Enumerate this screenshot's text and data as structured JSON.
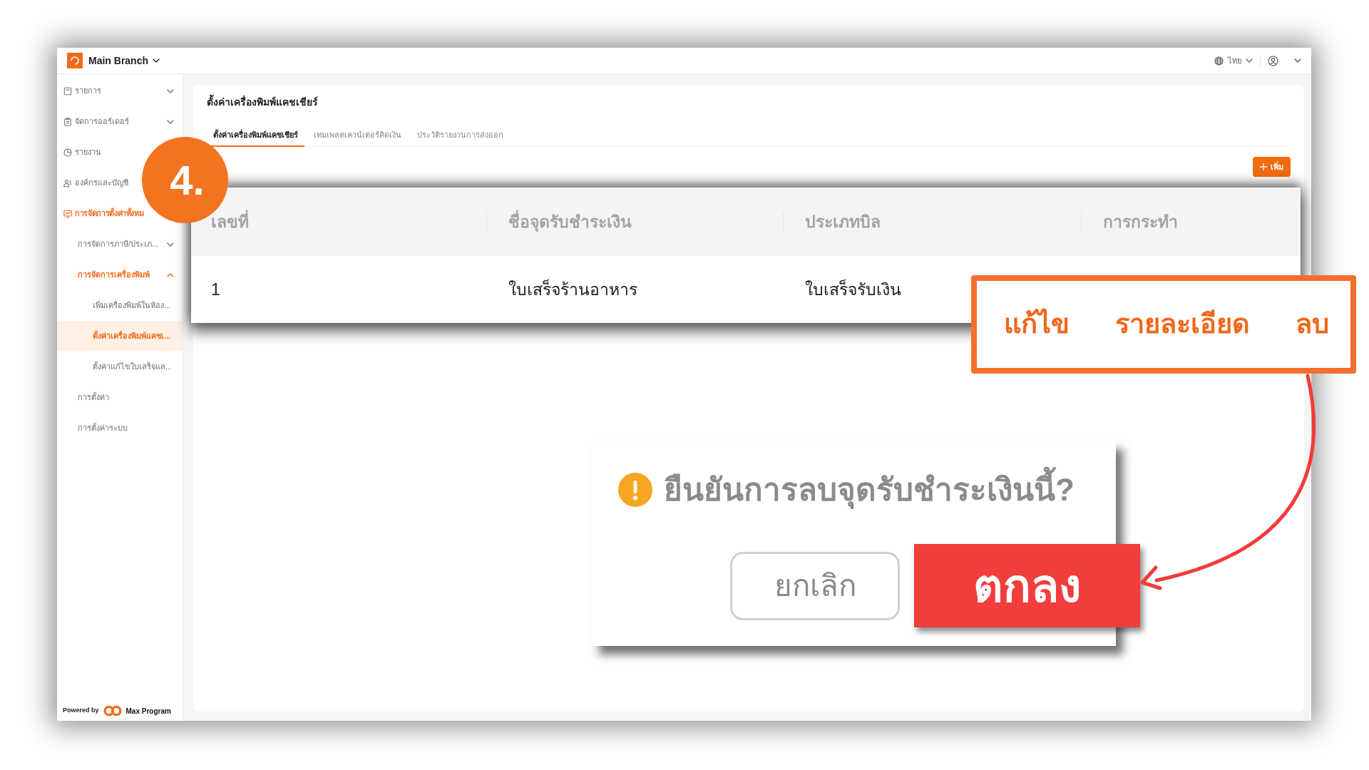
{
  "top_bar": {
    "branch": "Main Branch",
    "language": "ไทย"
  },
  "sidebar": {
    "items": [
      {
        "label": "รายการ",
        "expanded": false,
        "selected": false
      },
      {
        "label": "จัดการออร์เดอร์",
        "expanded": false,
        "selected": false
      },
      {
        "label": "รายงาน",
        "selected": false
      },
      {
        "label": "องค์กรและบัญชี",
        "selected": false
      },
      {
        "label": "การจัดการตั้งค่าทั้งหม",
        "selected": false,
        "children": [
          {
            "label": "การจัดการภาษี/ประเภ...",
            "expanded": false,
            "selected": false
          },
          {
            "label": "การจัดการเครื่องพิมพ์",
            "expanded": true,
            "selected": false,
            "children": [
              {
                "label": "เพิ่มเครื่องพิมพ์ในห้อง...",
                "selected": false
              },
              {
                "label": "ตั้งค่าเครื่องพิมพ์แคชเ...",
                "selected": true
              },
              {
                "label": "ตั้งค่าแก้ไขใบเสร็จแล...",
                "selected": false
              }
            ]
          },
          {
            "label": "การตั้งค่า",
            "selected": false
          },
          {
            "label": "การตั้งค่าระบบ",
            "selected": false
          }
        ]
      }
    ],
    "footer": {
      "powered_by": "Powered by",
      "brand": "Max Program"
    }
  },
  "card": {
    "title": "ตั้งค่าเครื่องพิมพ์แคชเชียร์",
    "tabs": [
      {
        "label": "ตั้งค่าเครื่องพิมพ์แคชเชียร์",
        "selected": true
      },
      {
        "label": "เทมเพลตเคาน์เตอร์คิดเงิน",
        "selected": false
      },
      {
        "label": "ประวัติรายงานการส่งออก",
        "selected": false
      }
    ],
    "add_button": "เพิ่ม"
  },
  "step_badge": "4.",
  "table": {
    "columns": [
      "เลขที่",
      "ชื่อจุดรับชำระเงิน",
      "ประเภทบิล",
      "การกระทำ"
    ],
    "rows": [
      [
        "1",
        "ใบเสร็จร้านอาหาร",
        "ใบเสร็จรับเงิน"
      ]
    ]
  },
  "callout": {
    "actions": [
      "แก้ไข",
      "รายละเอียด",
      "ลบ"
    ]
  },
  "confirm": {
    "message": "ยืนยันการลบจุดรับชำระเงินนี้?",
    "cancel": "ยกเลิก",
    "ok": "ตกลง"
  }
}
